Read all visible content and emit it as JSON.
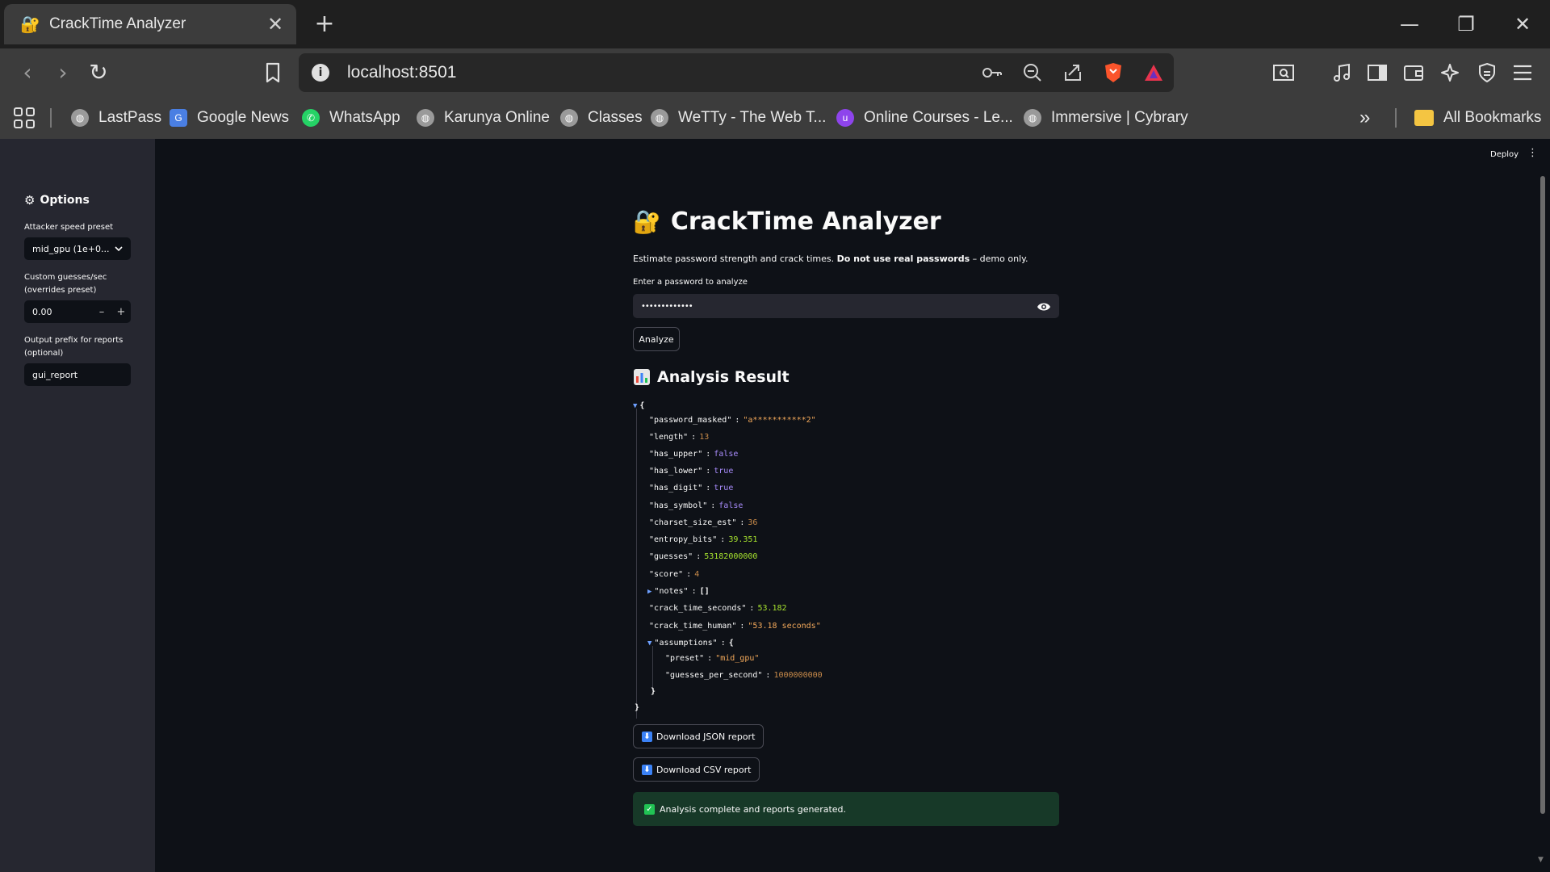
{
  "browser": {
    "tab": {
      "title": "CrackTime Analyzer",
      "favicon": "🔐",
      "close": "✕"
    },
    "new_tab": "+",
    "window_controls": {
      "minimize": "—",
      "restore": "❐",
      "close": "✕"
    },
    "nav": {
      "back": "‹",
      "forward": "›",
      "reload": "↻"
    },
    "url": "localhost:8501",
    "info_icon": "i",
    "bookmarks": [
      {
        "label": "LastPass",
        "icon": "globe-icon"
      },
      {
        "label": "Google News",
        "icon": "google-news-icon"
      },
      {
        "label": "WhatsApp",
        "icon": "whatsapp-icon"
      },
      {
        "label": "Karunya Online",
        "icon": "globe-icon"
      },
      {
        "label": "Classes",
        "icon": "globe-icon"
      },
      {
        "label": "WeTTy - The Web T...",
        "icon": "globe-icon"
      },
      {
        "label": "Online Courses - Le...",
        "icon": "udemy-icon"
      },
      {
        "label": "Immersive | Cybrary",
        "icon": "globe-icon"
      }
    ],
    "more_bookmarks": "»",
    "all_bookmarks": "All Bookmarks"
  },
  "sidebar": {
    "title": "Options",
    "preset_label": "Attacker speed preset",
    "preset_value": "mid_gpu (1e+0...",
    "custom_label_1": "Custom guesses/sec",
    "custom_label_2": "(overrides preset)",
    "custom_value": "0.00",
    "minus": "–",
    "plus": "+",
    "prefix_label_1": "Output prefix for reports",
    "prefix_label_2": "(optional)",
    "prefix_value": "gui_report"
  },
  "header": {
    "deploy": "Deploy",
    "menu": "⋮"
  },
  "main": {
    "title_emoji": "🔐",
    "title": "CrackTime Analyzer",
    "desc_plain": "Estimate password strength and crack times. ",
    "desc_bold": "Do not use real passwords",
    "desc_tail": " – demo only.",
    "pw_label": "Enter a password to analyze",
    "pw_value": "•••••••••••••",
    "analyze": "Analyze",
    "result_title": "Analysis Result",
    "json_open": "{",
    "json_close": "}",
    "json": {
      "password_masked": {
        "key": "\"password_masked\"",
        "value": "\"a***********2\""
      },
      "length": {
        "key": "\"length\"",
        "value": "13"
      },
      "has_upper": {
        "key": "\"has_upper\"",
        "value": "false"
      },
      "has_lower": {
        "key": "\"has_lower\"",
        "value": "true"
      },
      "has_digit": {
        "key": "\"has_digit\"",
        "value": "true"
      },
      "has_symbol": {
        "key": "\"has_symbol\"",
        "value": "false"
      },
      "charset_size_est": {
        "key": "\"charset_size_est\"",
        "value": "36"
      },
      "entropy_bits": {
        "key": "\"entropy_bits\"",
        "value": "39.351"
      },
      "guesses": {
        "key": "\"guesses\"",
        "value": "53182000000"
      },
      "score": {
        "key": "\"score\"",
        "value": "4"
      },
      "notes": {
        "key": "\"notes\"",
        "value": "[]"
      },
      "crack_time_seconds": {
        "key": "\"crack_time_seconds\"",
        "value": "53.182"
      },
      "crack_time_human": {
        "key": "\"crack_time_human\"",
        "value": "\"53.18 seconds\""
      },
      "assumptions": {
        "key": "\"assumptions\"",
        "open": "{",
        "close": "}"
      },
      "preset": {
        "key": "\"preset\"",
        "value": "\"mid_gpu\""
      },
      "guesses_per_second": {
        "key": "\"guesses_per_second\"",
        "value": "1000000000"
      }
    },
    "download_json": "Download JSON report",
    "download_csv": "Download CSV report",
    "download_icon": "⬇",
    "success_icon": "✓",
    "success": "Analysis complete and reports generated."
  },
  "colors": {
    "app_bg": "#0e1117",
    "sidebar_bg": "#262730",
    "string": "#f2a85a",
    "number_green": "#a6e22e",
    "boolean": "#a78bfa",
    "success_bg": "#173928",
    "accent_blue": "#3b82f6"
  }
}
